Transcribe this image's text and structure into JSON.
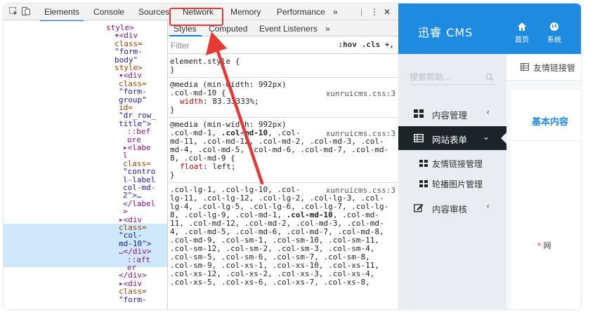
{
  "devtools": {
    "tabs": [
      "Elements",
      "Console",
      "Sources",
      "Network",
      "Memory",
      "Performance",
      "»"
    ],
    "active_tab": "Elements",
    "highlighted_tab": "Network",
    "more_symbol": "⋮",
    "close_symbol": "✕",
    "dom_lines": [
      {
        "k": "t",
        "s": "style>"
      },
      {
        "k": "t",
        "s": "▾<div"
      },
      {
        "k": "a",
        "s": "class="
      },
      {
        "k": "v",
        "s": "\"form-"
      },
      {
        "k": "v",
        "s": "body\""
      },
      {
        "k": "a",
        "s": "style>"
      },
      {
        "k": "t",
        "s": "▾<div"
      },
      {
        "k": "a",
        "s": "class="
      },
      {
        "k": "v",
        "s": "\"form-"
      },
      {
        "k": "v",
        "s": "group\""
      },
      {
        "k": "a",
        "s": "id="
      },
      {
        "k": "v",
        "s": "\"dr_row_"
      },
      {
        "k": "v",
        "s": "title\">"
      },
      {
        "k": "p",
        "s": "::bef"
      },
      {
        "k": "p",
        "s": "ore"
      },
      {
        "k": "t",
        "s": "▸<labe"
      },
      {
        "k": "t",
        "s": "l"
      },
      {
        "k": "a",
        "s": "class="
      },
      {
        "k": "v",
        "s": "\"contro"
      },
      {
        "k": "v",
        "s": "l-label"
      },
      {
        "k": "v",
        "s": "col-md-"
      },
      {
        "k": "v",
        "s": "2\">…"
      },
      {
        "k": "t",
        "s": "</label"
      },
      {
        "k": "t",
        "s": ">"
      },
      {
        "k": "t",
        "s": "▸<div"
      },
      {
        "k": "a",
        "s": "class="
      },
      {
        "k": "v",
        "s": "\"col-"
      },
      {
        "k": "v",
        "s": "md-10\">"
      },
      {
        "k": "t",
        "s": "…</div>"
      },
      {
        "k": "p",
        "s": "::aft"
      },
      {
        "k": "p",
        "s": "er"
      },
      {
        "k": "t",
        "s": "</div>"
      },
      {
        "k": "t",
        "s": "▸<div"
      },
      {
        "k": "a",
        "s": "class="
      },
      {
        "k": "v",
        "s": "\"form-"
      }
    ],
    "styles_tabs": [
      "Styles",
      "Computed",
      "Event Listeners",
      "»"
    ],
    "filter_placeholder": "Filter",
    "filter_tools": ":hov .cls +,",
    "rules": {
      "r1_a": "element.style {",
      "r1_b": "}",
      "r2_media": "@media (min-width: 992px)",
      "r2_sel": ".col-md-10 {",
      "r2_src": "xunruicms.css:3",
      "r2_prop": "width",
      "r2_val": ": 83.33333%;",
      "r2_end": "}",
      "r3_media": "@media (min-width: 992px)",
      "r3_l1_a": ".col-md-1, ",
      "r3_l1_b": ".col-md-10",
      "r3_l1_c": ", .col-",
      "r3_src": "xunruicms.css:3",
      "r3_l2": "md-11, .col-md-12, .col-md-2, .col-md-3, .col-",
      "r3_l3": "md-4, .col-md-5, .col-md-6, .col-md-7, .col-md-",
      "r3_l4": "8, .col-md-9 {",
      "r3_prop": "float",
      "r3_val": ": left;",
      "r3_end": "}",
      "r4_l1": ".col-lg-1, .col-lg-10, .col-",
      "r4_src": "xunruicms.css:3",
      "r4_l2": "lg-11, .col-lg-12, .col-lg-2, .col-lg-3, .col-",
      "r4_l3": "lg-4, .col-lg-5, .col-lg-6, .col-lg-7, .col-lg-",
      "r4_l4_a": "8, .col-lg-9, .col-md-1, ",
      "r4_l4_b": ".col-md-10",
      "r4_l4_c": ", .col-md-",
      "r4_l5": "11, .col-md-12, .col-md-2, .col-md-3, .col-md-",
      "r4_l6": "4, .col-md-5, .col-md-6, .col-md-7, .col-md-8,",
      "r4_l7": ".col-md-9, .col-sm-1, .col-sm-10, .col-sm-11,",
      "r4_l8": ".col-sm-12, .col-sm-2, .col-sm-3, .col-sm-4,",
      "r4_l9": ".col-sm-5, .col-sm-6, .col-sm-7, .col-sm-8,",
      "r4_l10": ".col-sm-9, .col-xs-1, .col-xs-10, .col-xs-11,",
      "r4_l11": ".col-xs-12, .col-xs-2, .col-xs-3, .col-xs-4,",
      "r4_l12": ".col-xs-5, .col-xs-6, .col-xs-7, .col-xs-8,"
    }
  },
  "cms": {
    "logo": "迅睿 CMS",
    "top_nav": [
      {
        "label": "首页",
        "icon": "home-icon"
      },
      {
        "label": "系统",
        "icon": "globe-icon"
      }
    ],
    "search_placeholder": "搜索帮助...",
    "sidebar": {
      "content_manage": "内容管理",
      "site_forms": "网站表单",
      "sub_links": "友情链接管理",
      "sub_carousel": "轮播图片管理",
      "content_review": "内容审核"
    },
    "breadcrumb": "友情链接管",
    "card_title": "基本内容",
    "field_required": "*",
    "field_label": "网"
  },
  "colors": {
    "cms_blue": "#1e8ae0",
    "sidebar_bg": "#e9edf1",
    "sidebar_active": "#1d2329",
    "highlight_red": "#e53935",
    "dom_selection": "#cfe8fc"
  }
}
